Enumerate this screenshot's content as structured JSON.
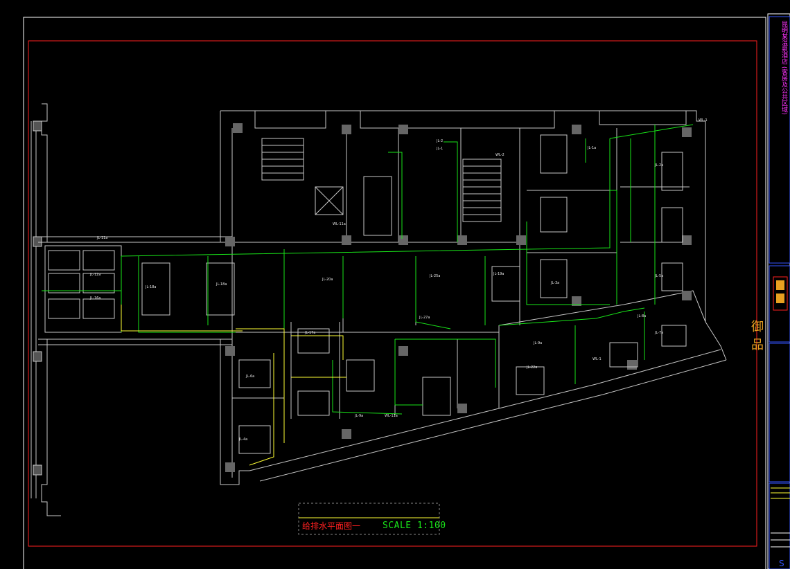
{
  "drawing": {
    "title": "给排水平面图一",
    "scale": "SCALE 1:100"
  },
  "title_block": {
    "project_text": "昆明某温泉酒店 (客房及公共区域)",
    "logo_text": "御品"
  },
  "room_labels": [
    "JL-11a",
    "WL-11a",
    "JL-2",
    "JL-1",
    "WL-2",
    "JL-1a",
    "JL-2a",
    "WL-1",
    "JL-20a",
    "JL-25a",
    "JL-19a",
    "JL-27a",
    "JL-8a",
    "JL-7a",
    "JL-9a",
    "JL-22a",
    "JL-12a",
    "JL-16a",
    "JL-18a",
    "JL-17a",
    "WL-11a",
    "JL-5a",
    "JL-6a",
    "JL-4a",
    "JL-3a",
    "WL-1",
    "JL-9a",
    "JL-18a"
  ],
  "colors": {
    "walls": "#c8c8c8",
    "pipes_green": "#19e619",
    "pipes_yellow": "#ffff33",
    "frame_red": "#ff2020",
    "frame_white": "#ffffff",
    "titleblock_blue": "#3355ff"
  }
}
